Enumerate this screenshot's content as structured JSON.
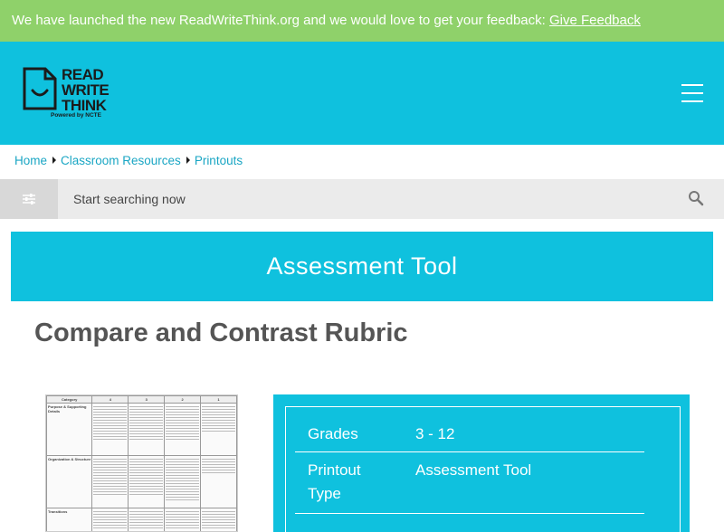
{
  "banner": {
    "text": "We have launched the new ReadWriteThink.org and we would love to get your feedback: ",
    "link": "Give Feedback"
  },
  "logo": {
    "line1": "READ",
    "line2": "WRITE",
    "line3": "THINK",
    "sub": "Powered by NCTE"
  },
  "breadcrumb": [
    "Home",
    "Classroom Resources",
    "Printouts"
  ],
  "search": {
    "placeholder": "Start searching now"
  },
  "section_banner": "Assessment Tool",
  "page_title": "Compare and Contrast Rubric",
  "details": [
    {
      "label": "Grades",
      "value": "3 - 12"
    },
    {
      "label": "Printout Type",
      "value": "Assessment Tool"
    }
  ],
  "thumbnail": {
    "headers": [
      "Category",
      "4",
      "3",
      "2",
      "1"
    ],
    "rows": [
      "Purpose & Supporting Details",
      "Organization & Structure",
      "Transitions"
    ]
  },
  "colors": {
    "banner": "#8fd16a",
    "brand": "#0fc1de",
    "link": "#1aa6c4"
  }
}
